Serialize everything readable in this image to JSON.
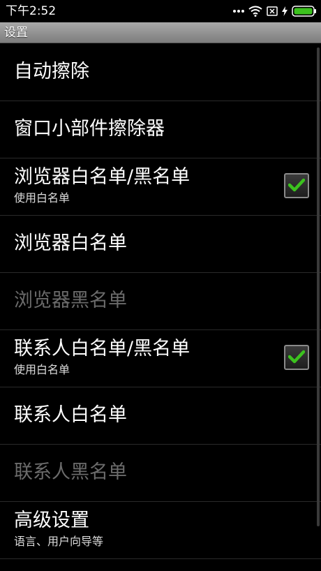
{
  "status_bar": {
    "time": "下午2:52",
    "icons": [
      "more-dots-icon",
      "wifi-icon",
      "sim-x-icon",
      "charging-bolt-icon",
      "battery-icon"
    ],
    "battery_color": "#3cc21e"
  },
  "title_bar": {
    "title": "设置"
  },
  "settings": {
    "items": [
      {
        "title": "自动擦除",
        "subtitle": "",
        "enabled": true
      },
      {
        "title": "窗口小部件擦除器",
        "subtitle": "",
        "enabled": true
      },
      {
        "title": "浏览器白名单/黑名单",
        "subtitle": "使用白名单",
        "checked": true,
        "enabled": true
      },
      {
        "title": "浏览器白名单",
        "subtitle": "",
        "enabled": true
      },
      {
        "title": "浏览器黑名单",
        "subtitle": "",
        "enabled": false
      },
      {
        "title": "联系人白名单/黑名单",
        "subtitle": "使用白名单",
        "checked": true,
        "enabled": true
      },
      {
        "title": "联系人白名单",
        "subtitle": "",
        "enabled": true
      },
      {
        "title": "联系人黑名单",
        "subtitle": "",
        "enabled": false
      },
      {
        "title": "高级设置",
        "subtitle": "语言、用户向导等",
        "enabled": true
      }
    ]
  },
  "colors": {
    "background": "#000000",
    "disabled_text": "#6b6b6b",
    "check_green": "#3cc21e"
  }
}
